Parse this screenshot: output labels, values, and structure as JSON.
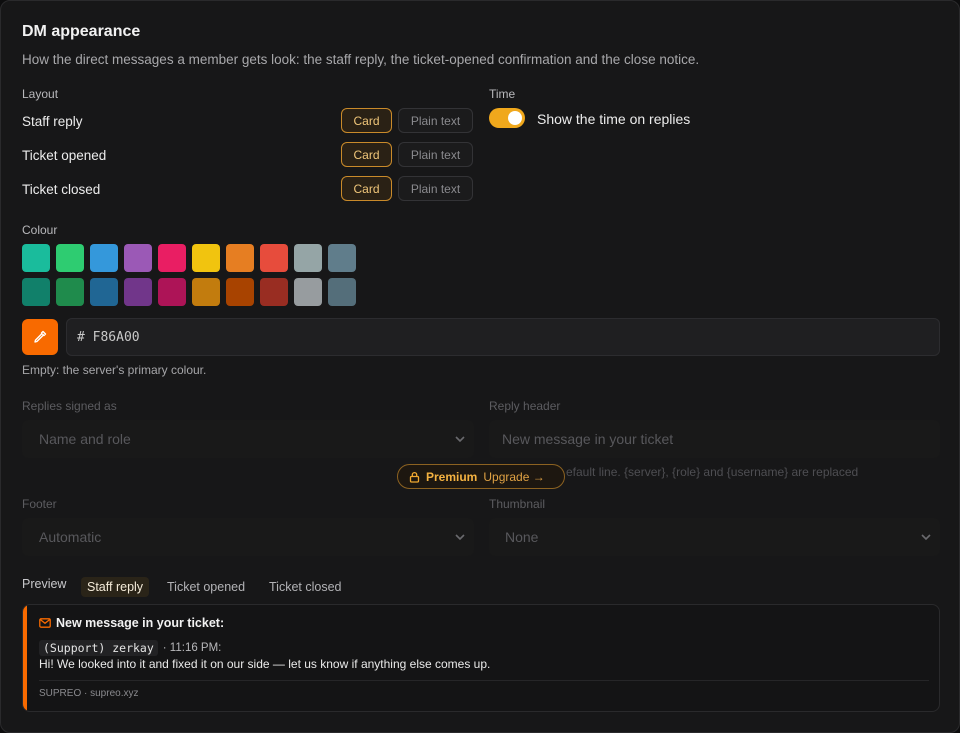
{
  "title": "DM appearance",
  "description": "How the direct messages a member gets look: the staff reply, the ticket-opened confirmation and the close notice.",
  "layout": {
    "label": "Layout",
    "rows": [
      {
        "label": "Staff reply",
        "card": "Card",
        "plain": "Plain text",
        "selected": "Card"
      },
      {
        "label": "Ticket opened",
        "card": "Card",
        "plain": "Plain text",
        "selected": "Card"
      },
      {
        "label": "Ticket closed",
        "card": "Card",
        "plain": "Plain text",
        "selected": "Card"
      }
    ]
  },
  "time": {
    "label": "Time",
    "toggle_label": "Show the time on replies",
    "enabled": true
  },
  "colour": {
    "label": "Colour",
    "swatches_row1": [
      "#1abc9c",
      "#2ecc71",
      "#3498db",
      "#9b59b6",
      "#e91e63",
      "#f1c40f",
      "#e67e22",
      "#e74c3c",
      "#95a5a6",
      "#607d8b"
    ],
    "swatches_row2": [
      "#11806a",
      "#1f8b4c",
      "#206694",
      "#71368a",
      "#ad1457",
      "#c27c0e",
      "#a84300",
      "#992d22",
      "#979c9f",
      "#546e7a"
    ],
    "picker_icon": "eyedropper-icon",
    "hex_value": "# F86A00",
    "hint": "Empty: the server's primary colour.",
    "accent": "#f86a00"
  },
  "signed_as": {
    "label": "Replies signed as",
    "value": "Name and role"
  },
  "reply_header": {
    "label": "Reply header",
    "placeholder": "New message in your ticket",
    "hint_partial": "efault line. {server}, {role} and {username} are replaced"
  },
  "premium": {
    "icon": "lock-icon",
    "label": "Premium",
    "upgrade": "Upgrade →"
  },
  "footer": {
    "label": "Footer",
    "value": "Automatic"
  },
  "thumbnail": {
    "label": "Thumbnail",
    "value": "None"
  },
  "preview": {
    "label": "Preview",
    "tabs": [
      "Staff reply",
      "Ticket opened",
      "Ticket closed"
    ],
    "active_tab": "Staff reply",
    "heading_icon": "envelope-icon",
    "heading": "New message in your ticket:",
    "author": "(Support) zerkay",
    "time": "· 11:16 PM:",
    "message": "Hi! We looked into it and fixed it on our side — let us know if anything else comes up.",
    "footer": "SUPREO · supreo.xyz"
  }
}
